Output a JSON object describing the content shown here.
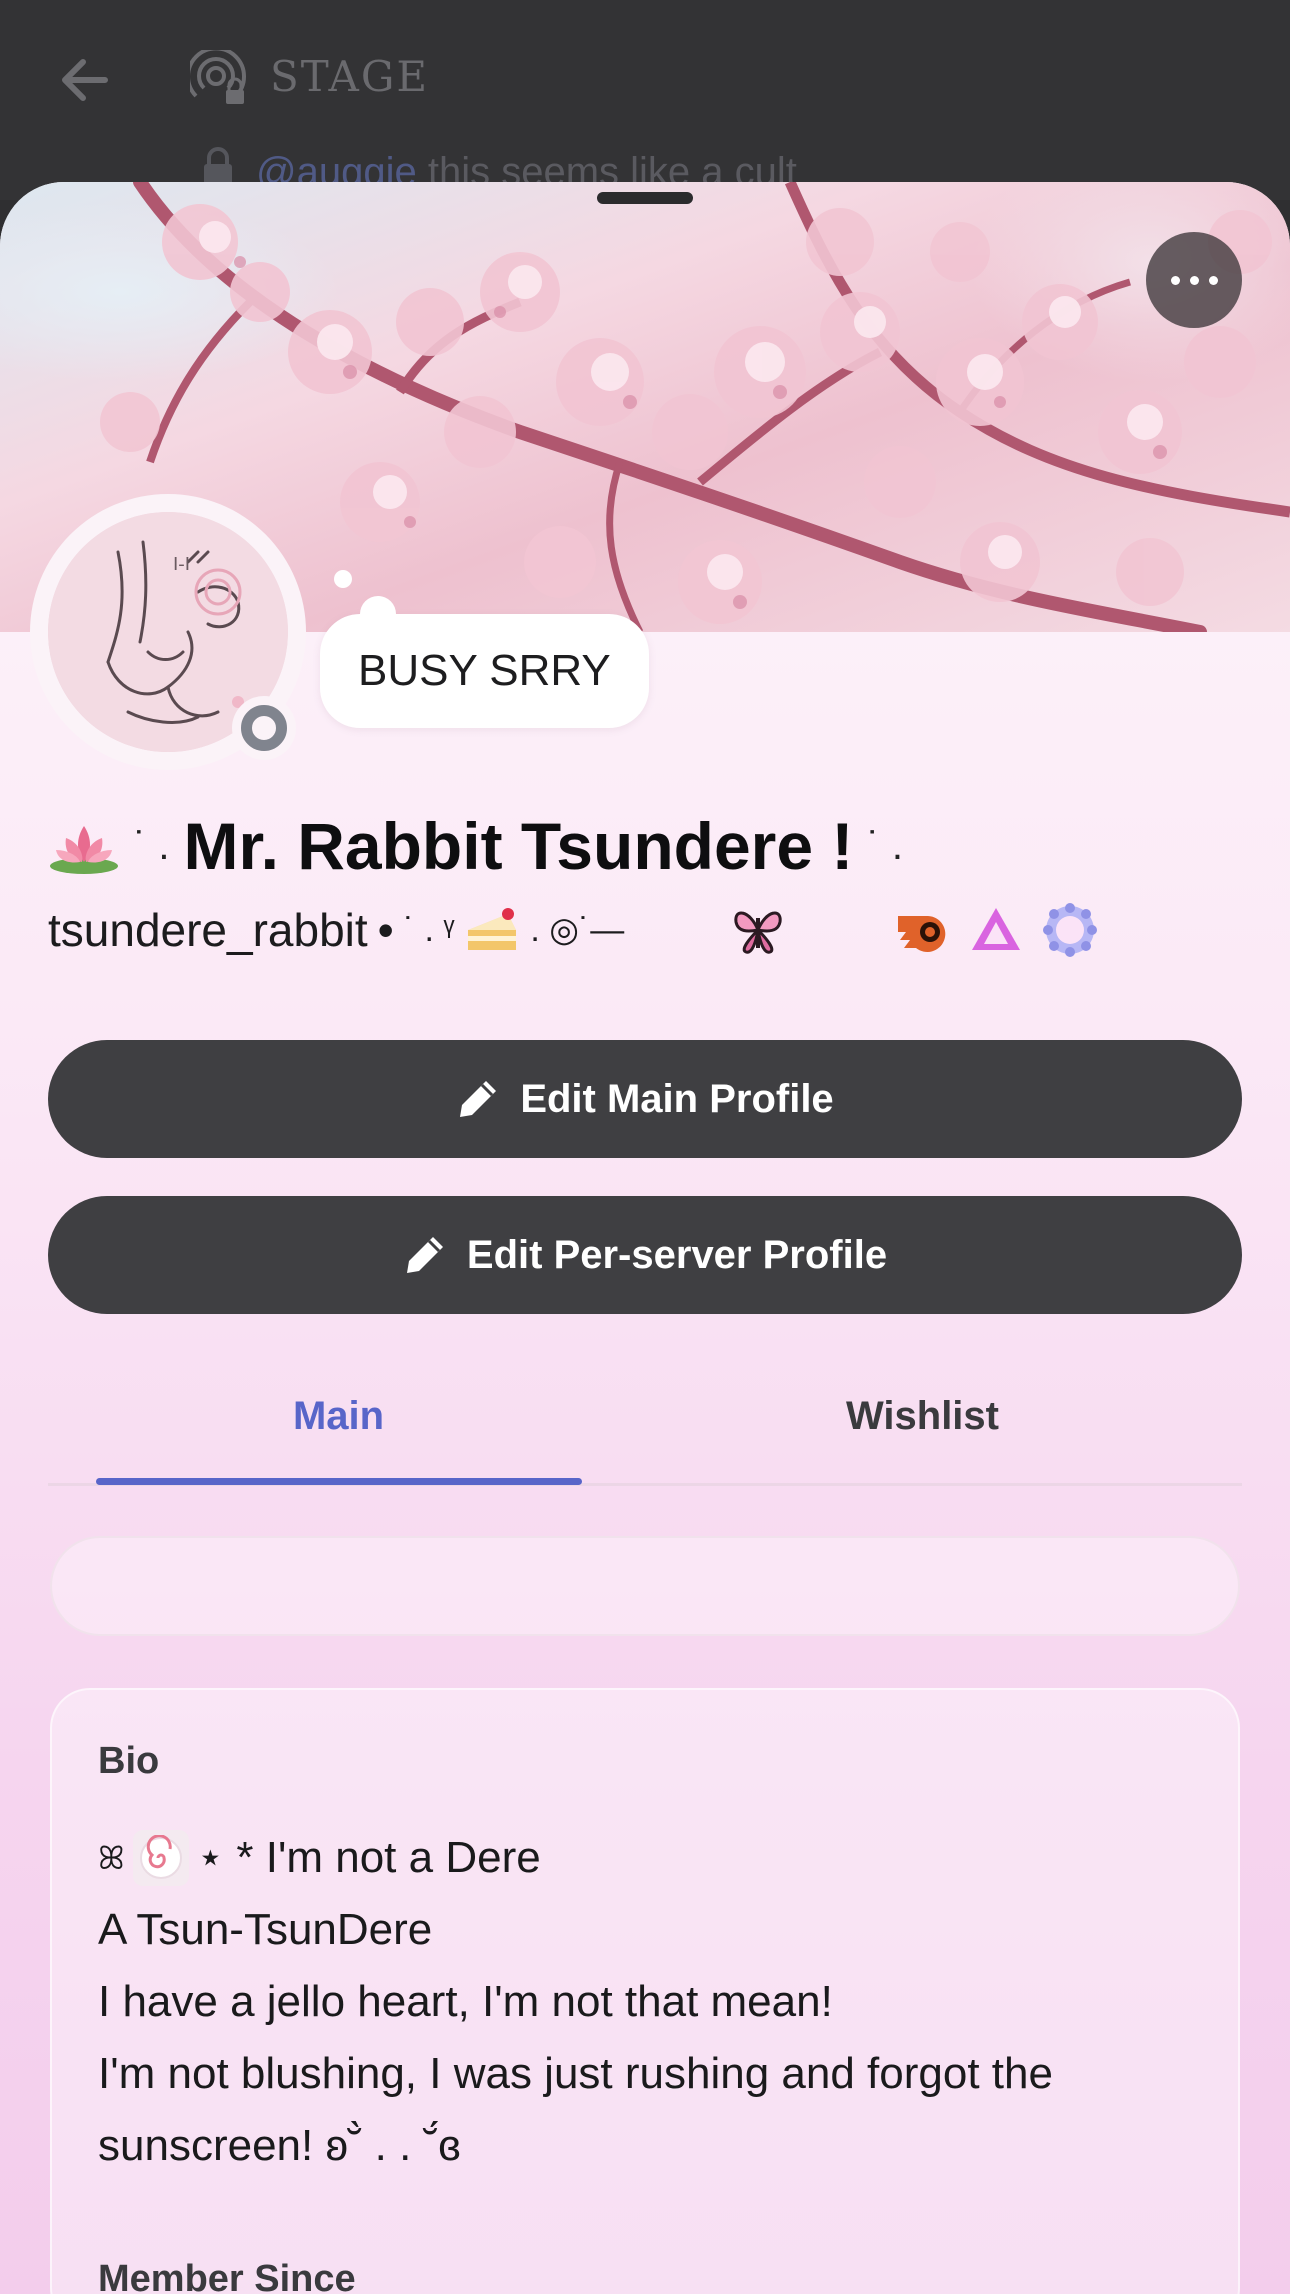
{
  "background_chat": {
    "channel_title": "STAGE",
    "message_mention": "@auggie",
    "message_text": " this seems like a cult"
  },
  "profile": {
    "custom_status": "BUSY SRRY",
    "display_name_prefix": "˙ .",
    "display_name": "Mr. Rabbit Tsundere !",
    "display_name_suffix": "˙ .",
    "username": "tsundere_rabbit",
    "username_separator": "•",
    "pronouns_deco_left": "˙ . ᵞ",
    "pronouns_deco_right": ". ◎˙—",
    "status_color": "#80848e",
    "badges": [
      "butterfly-badge-icon",
      "nitro-badge-icon",
      "hypesquad-badge-icon",
      "boost-badge-icon"
    ]
  },
  "actions": {
    "edit_main_label": "Edit Main Profile",
    "edit_server_label": "Edit Per-server Profile"
  },
  "tabs": {
    "main_label": "Main",
    "wishlist_label": "Wishlist",
    "active_color": "#5865c9"
  },
  "bio": {
    "title": "Bio",
    "line1_prefix": "ꕤ",
    "line1_text": "⋆ * I'm not a Dere",
    "line2": "A Tsun-TsunDere",
    "line3": "I have a jello heart, I'm not that mean!",
    "line4": "I'm not blushing, I was just rushing and forgot the",
    "line5": "sunscreen! ʚ˘̀ . . ˘́ɞ"
  },
  "member_since": {
    "title": "Member Since"
  }
}
